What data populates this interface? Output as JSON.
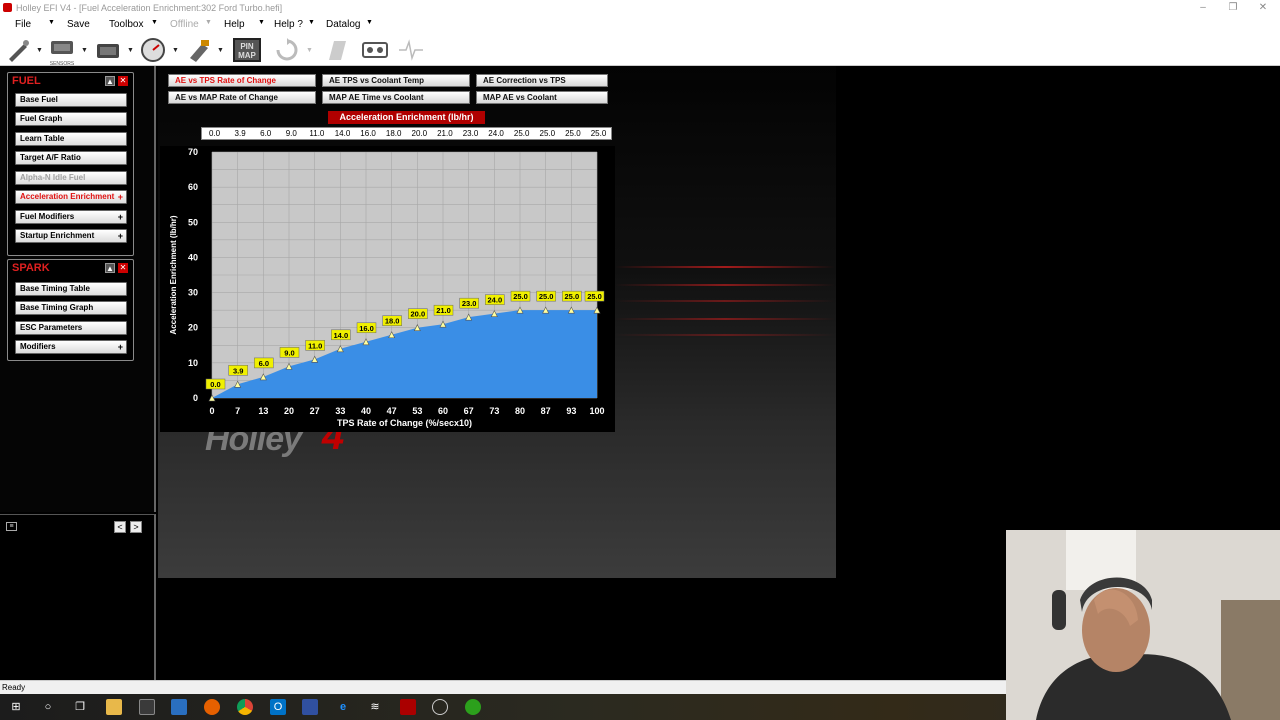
{
  "window": {
    "title": "Holley EFI V4 - [Fuel Acceleration Enrichment:302 Ford Turbo.hefi]",
    "min": "–",
    "max": "❐",
    "close": "✕"
  },
  "menu": [
    {
      "label": "File",
      "disabled": false
    },
    {
      "label": "Save",
      "disabled": false
    },
    {
      "label": "Toolbox",
      "disabled": false
    },
    {
      "label": "Offline",
      "disabled": true
    },
    {
      "label": "Help",
      "disabled": false
    },
    {
      "label": "Help ?",
      "disabled": false
    },
    {
      "label": "Datalog",
      "disabled": false
    }
  ],
  "toolbar": {
    "icons": [
      "tuning-wand-icon",
      "sensors-icon",
      "ecu-icon",
      "gauge-icon",
      "injector-icon",
      "pin-map-icon",
      "refresh-icon",
      "paper-icon",
      "datalog-tape-icon",
      "waveform-icon"
    ],
    "sensors_label": "SENSORS",
    "pin_map_label": "PIN MAP"
  },
  "fuel_group": {
    "title": "FUEL",
    "items": [
      {
        "label": "Base Fuel",
        "state": "normal",
        "plus": ""
      },
      {
        "label": "Fuel Graph",
        "state": "normal",
        "plus": ""
      },
      {
        "label": "Learn Table",
        "state": "normal",
        "plus": ""
      },
      {
        "label": "Target A/F Ratio",
        "state": "normal",
        "plus": ""
      },
      {
        "label": "Alpha-N Idle Fuel",
        "state": "disabled",
        "plus": ""
      },
      {
        "label": "Acceleration Enrichment",
        "state": "active",
        "plus": "+"
      },
      {
        "label": "Fuel Modifiers",
        "state": "normal",
        "plus": "+"
      },
      {
        "label": "Startup Enrichment",
        "state": "normal",
        "plus": "+"
      }
    ]
  },
  "spark_group": {
    "title": "SPARK",
    "items": [
      {
        "label": "Base Timing Table",
        "state": "normal",
        "plus": ""
      },
      {
        "label": "Base Timing Graph",
        "state": "normal",
        "plus": ""
      },
      {
        "label": "ESC Parameters",
        "state": "normal",
        "plus": ""
      },
      {
        "label": "Modifiers",
        "state": "normal",
        "plus": "+"
      }
    ]
  },
  "lower_panel": {
    "nav_prev": "<",
    "nav_next": ">"
  },
  "tabs": [
    {
      "label": "AE vs TPS Rate of Change",
      "active": true
    },
    {
      "label": "AE TPS vs Coolant Temp",
      "active": false
    },
    {
      "label": "AE Correction vs TPS",
      "active": false
    },
    {
      "label": "AE vs MAP Rate of Change",
      "active": false
    },
    {
      "label": "MAP AE Time vs Coolant",
      "active": false
    },
    {
      "label": "MAP AE vs Coolant",
      "active": false
    }
  ],
  "chart_title": "Acceleration Enrichment (lb/hr)",
  "value_row": [
    "0.0",
    "3.9",
    "6.0",
    "9.0",
    "11.0",
    "14.0",
    "16.0",
    "18.0",
    "20.0",
    "21.0",
    "23.0",
    "24.0",
    "25.0",
    "25.0",
    "25.0",
    "25.0"
  ],
  "chart_data": {
    "type": "area",
    "title": "Acceleration Enrichment (lb/hr)",
    "xlabel": "TPS Rate of Change (%/secx10)",
    "ylabel": "Acceleration Enrichment (lb/hr)",
    "x": [
      0,
      7,
      13,
      20,
      27,
      33,
      40,
      47,
      53,
      60,
      67,
      73,
      80,
      87,
      93,
      100
    ],
    "x_tick_labels": [
      "0",
      "7",
      "13",
      "20",
      "27",
      "33",
      "40",
      "47",
      "53",
      "60",
      "67",
      "73",
      "80",
      "87",
      "93",
      "100"
    ],
    "values": [
      0.0,
      3.9,
      6.0,
      9.0,
      11.0,
      14.0,
      16.0,
      18.0,
      20.0,
      21.0,
      23.0,
      24.0,
      25.0,
      25.0,
      25.0,
      25.0
    ],
    "data_labels": [
      "0.0",
      "3.9",
      "6.0",
      "9.0",
      "11.0",
      "14.0",
      "16.0",
      "18.0",
      "20.0",
      "21.0",
      "23.0",
      "24.0",
      "25.0",
      "25.0",
      "25.0",
      "25.0"
    ],
    "ylim": [
      0,
      70
    ],
    "y_ticks": [
      0,
      10,
      20,
      30,
      40,
      50,
      60,
      70
    ],
    "grid": true,
    "fill_color": "#3a8ee6",
    "plot_bg": "#c8c8c8",
    "label_bg": "#f0f000"
  },
  "background_logo": {
    "text": "Holley",
    "mark": "4"
  },
  "status": "Ready",
  "taskbar": {
    "icons": [
      "windows-start-icon",
      "cortana-icon",
      "task-view-icon",
      "file-explorer-icon",
      "store-icon",
      "calculator-icon",
      "firefox-icon",
      "chrome-icon",
      "outlook-icon",
      "visual-studio-icon",
      "edge-icon",
      "wifi-icon",
      "holley-efi-icon",
      "tuning-icon",
      "quickbooks-icon"
    ]
  },
  "colors": {
    "accent_red": "#e01010",
    "fuel_title": "#e02020",
    "panel_border": "#8a8a8a"
  }
}
